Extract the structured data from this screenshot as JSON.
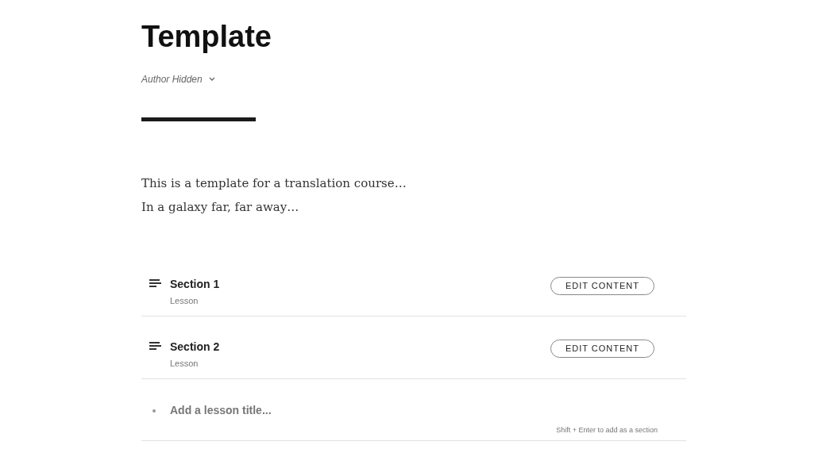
{
  "title": "Template",
  "author": "Author Hidden",
  "description": [
    "This is a template for a translation course…",
    "In a galaxy far, far away…"
  ],
  "lessons": [
    {
      "title": "Section 1",
      "type": "Lesson",
      "button": "EDIT CONTENT"
    },
    {
      "title": "Section 2",
      "type": "Lesson",
      "button": "EDIT CONTENT"
    }
  ],
  "new_lesson": {
    "placeholder": "Add a lesson title...",
    "hint": "Shift + Enter to add as a section"
  }
}
